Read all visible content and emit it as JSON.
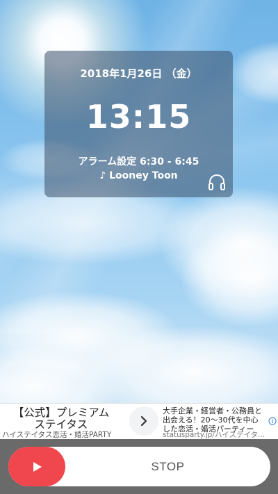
{
  "clock": {
    "date": "2018年1月26日 （金）",
    "time": "13:15",
    "alarm": "アラーム設定 6:30 - 6:45",
    "song": "♪ Looney Toon",
    "headphones_icon": "headphones-icon"
  },
  "ad": {
    "title_line1": "【公式】プレミアム",
    "title_line2": "ステイタス",
    "subtitle": "ハイステイタス恋活・婚活PARTY",
    "arrow_icon": "chevron-right-icon",
    "body_line1": "大手企業・経営者・公務員と",
    "body_line2": "出会える！20～30代を中心",
    "body_line3": "した恋活・婚活パーティー",
    "url": "statusparty.jp/ハイステイタ...",
    "info_icon": "info-icon"
  },
  "controls": {
    "play_icon": "play-icon",
    "stop_label": "STOP",
    "play_color": "#f0474e"
  }
}
